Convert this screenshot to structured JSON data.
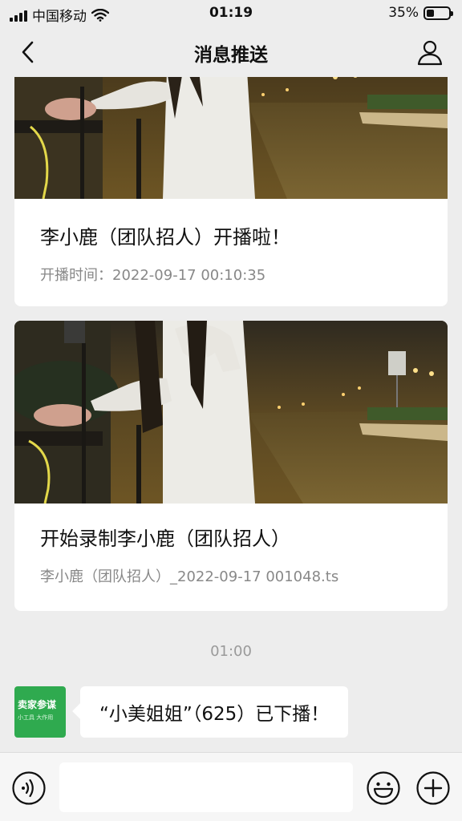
{
  "status_bar": {
    "carrier": "中国移动",
    "time": "01:19",
    "battery_percent_text": "35%",
    "battery_level": 0.35,
    "icons": [
      "signal-icon",
      "wifi-icon",
      "battery-icon"
    ]
  },
  "nav": {
    "title": "消息推送",
    "icons": [
      "back-icon",
      "profile-icon"
    ]
  },
  "messages": [
    {
      "title": "李小鹿（团队招人）开播啦！",
      "subtitle": "开播时间：2022-09-17 00:10:35"
    },
    {
      "title": "开始录制李小鹿（团队招人）",
      "subtitle": "李小鹿（团队招人）_2022-09-17 001048.ts"
    }
  ],
  "timestamp": "01:00",
  "chat": {
    "avatar_line1": "卖家参谋",
    "avatar_line2": "小工具 大作用",
    "text": "“小美姐姐”（625）已下播！"
  },
  "input_bar": {
    "icons": [
      "voice-icon",
      "emoji-icon",
      "plus-icon"
    ]
  },
  "colors": {
    "background": "#ededed",
    "card": "#ffffff",
    "avatar_green": "#2faa4f"
  }
}
